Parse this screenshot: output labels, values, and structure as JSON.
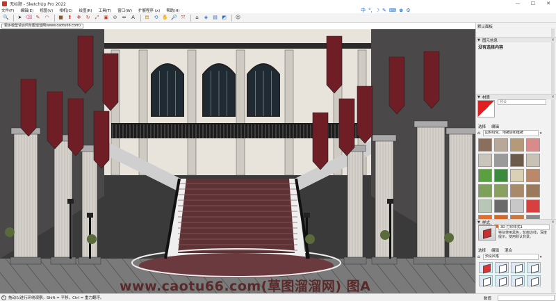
{
  "window": {
    "title": "无标题 - SketchUp Pro 2022",
    "controls": [
      "—",
      "☐",
      "✕"
    ]
  },
  "menu": [
    "文件(F)",
    "编辑(E)",
    "视图(V)",
    "相机(C)",
    "绘图(R)",
    "工具(T)",
    "窗口(W)",
    "扩展程序 (x)",
    "帮助(H)"
  ],
  "ime": {
    "items": [
      "中",
      "°,",
      "☽",
      "✎",
      "⌨",
      "♚",
      "⚙"
    ]
  },
  "toolbar": {
    "tools": [
      {
        "name": "search-icon",
        "glyph": "🔍",
        "color": "#333333"
      },
      {
        "name": "select-arrow-icon",
        "glyph": "➤",
        "color": "#222222"
      },
      {
        "name": "eraser-icon",
        "glyph": "⌫",
        "color": "#d05a8a"
      },
      {
        "name": "pencil-icon",
        "glyph": "✎",
        "color": "#c0392b"
      },
      {
        "name": "arc-icon",
        "glyph": "◠",
        "color": "#c0392b"
      },
      {
        "name": "rectangle-icon",
        "glyph": "■",
        "color": "#8b5a2b"
      },
      {
        "name": "push-pull-icon",
        "glyph": "⬆",
        "color": "#c0392b"
      },
      {
        "name": "move-icon",
        "glyph": "✥",
        "color": "#c0392b"
      },
      {
        "name": "rotate-icon",
        "glyph": "↻",
        "color": "#c0392b"
      },
      {
        "name": "scale-icon",
        "glyph": "⤢",
        "color": "#c0392b"
      },
      {
        "name": "offset-icon",
        "glyph": "▣",
        "color": "#c0392b"
      },
      {
        "name": "tape-measure-icon",
        "glyph": "⊘",
        "color": "#555555"
      },
      {
        "name": "dimension-icon",
        "glyph": "⇔",
        "color": "#333333"
      },
      {
        "name": "text-icon",
        "glyph": "A",
        "color": "#333333"
      },
      {
        "name": "paint-bucket-icon",
        "glyph": "⛾",
        "color": "#d89020"
      },
      {
        "name": "orbit-icon",
        "glyph": "⟲",
        "color": "#2f6db5"
      },
      {
        "name": "pan-icon",
        "glyph": "✋",
        "color": "#d89020"
      },
      {
        "name": "zoom-icon",
        "glyph": "🔎",
        "color": "#333333"
      },
      {
        "name": "zoom-extents-icon",
        "glyph": "⤧",
        "color": "#c0392b"
      },
      {
        "name": "warehouse-icon",
        "glyph": "⌂",
        "color": "#333333"
      },
      {
        "name": "extension-icon",
        "glyph": "◈",
        "color": "#2f6db5"
      },
      {
        "name": "layout-icon",
        "glyph": "▤",
        "color": "#2f6db5"
      },
      {
        "name": "styles-icon",
        "glyph": "◩",
        "color": "#2f6db5"
      },
      {
        "name": "account-icon",
        "glyph": "☺",
        "color": "#333333"
      }
    ]
  },
  "tab": {
    "label": "更多模型请访问草图溜溜网(www.caotu66.com)"
  },
  "scene": {
    "floor_color": "#7a7a7a",
    "wall_color": "#e8e4dc",
    "stair_color": "#5e3336",
    "banner_color": "#6e1e24"
  },
  "watermark": "www.caotu66.com(草图溜溜网) 图A",
  "tray": {
    "title": "默认面板",
    "entity_info": {
      "header": "图元信息",
      "text": "没有选择内容"
    },
    "materials": {
      "header": "材质",
      "name_placeholder": "预设",
      "tabs": [
        "选择",
        "编辑"
      ],
      "library": "园林绿化、地被层和植被",
      "swatches": [
        "#8a6f5c",
        "#b7a89a",
        "#b59a7a",
        "#d98a8a",
        "#c9c4bc",
        "#9a9a9a",
        "#6c5a4a",
        "#c8c2b6",
        "#5aa040",
        "#3c8a3c",
        "#d9d0b6",
        "#b9896a",
        "#7da05a",
        "#8aa060",
        "#a88a6a",
        "#9a7a5a",
        "#b8c6b8",
        "#6a6a6a",
        "#c8c8c8",
        "#d84040",
        "#e07030",
        "#d86828",
        "#c87840",
        "#8a8a8a"
      ]
    },
    "styles": {
      "header": "样式",
      "name": "3D 打印样式1",
      "desc": "特征使用黑色，轮廓边线，深度提示。使用默认背景。",
      "tabs": [
        "选择",
        "编辑",
        "混合"
      ],
      "library": "预设风格"
    }
  },
  "status": {
    "text": "拖动以进行环绕观察。Shift = 平移，Ctrl = 重力翻浮。",
    "measure_label": "数值"
  }
}
